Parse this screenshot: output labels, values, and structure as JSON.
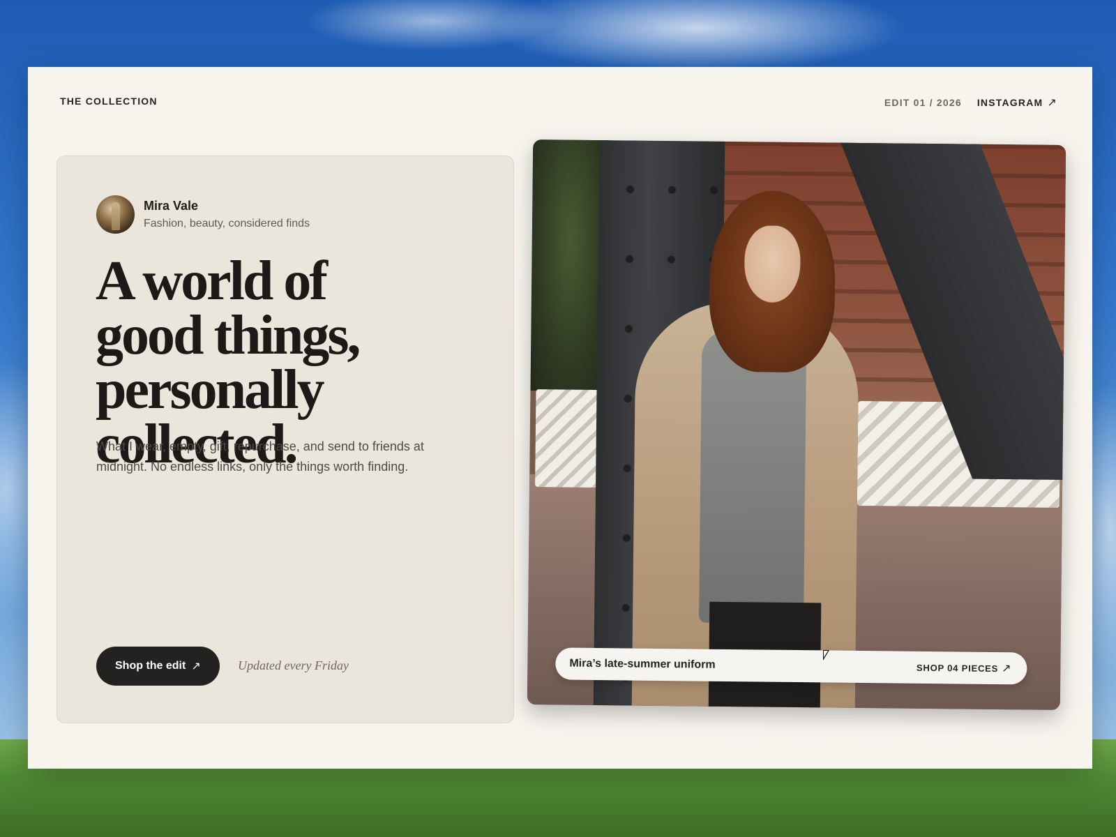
{
  "header": {
    "brand": "THE COLLECTION",
    "edit_label": "EDIT 01 / 2026",
    "instagram_label": "INSTAGRAM",
    "arrow": "↗"
  },
  "profile": {
    "name": "Mira Vale",
    "tagline": "Fashion, beauty, considered finds"
  },
  "hero": {
    "headline_lines": [
      "A world of",
      "good things,",
      "personally collected."
    ],
    "subcopy": "What I wear, empty, gift, repurchase, and send to friends at midnight. No endless links, only the things worth finding."
  },
  "cta": {
    "shop_label": "Shop the edit",
    "arrow": "↗",
    "updated_note": "Updated every Friday"
  },
  "feature": {
    "caption_title": "Mira’s late-summer uniform",
    "caption_cta": "SHOP 04 PIECES",
    "arrow": "↗"
  },
  "colors": {
    "page_bg": "#f7f4ee",
    "card_bg": "#ebe6dc",
    "button_bg": "#242220",
    "text_primary": "#1c1a17",
    "text_muted": "#6b6660"
  },
  "icons": {
    "external_link": "arrow-up-right-icon",
    "cursor": "mouse-pointer-icon"
  }
}
